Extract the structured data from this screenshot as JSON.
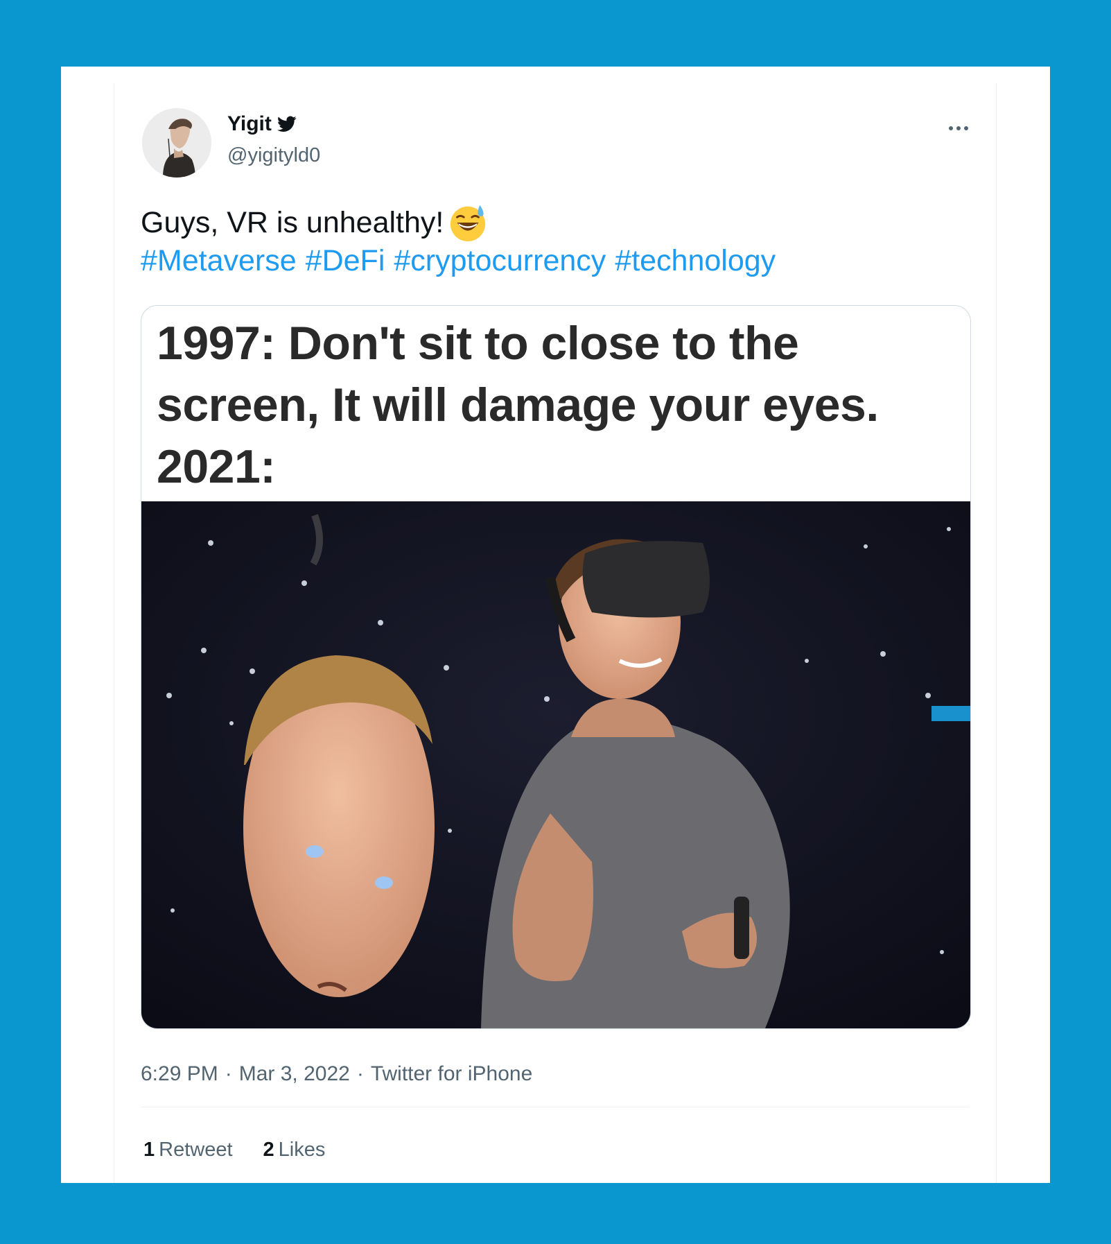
{
  "colors": {
    "background": "#0a97cf",
    "card": "#ffffff",
    "link": "#1d9bf0",
    "text_primary": "#0f1419",
    "text_secondary": "#536471"
  },
  "author": {
    "name": "Yigit",
    "handle": "@yigityld0",
    "verified_icon": "twitter-bird-icon"
  },
  "tweet": {
    "text": "Guys, VR is unhealthy!",
    "emoji": "grinning-face-with-sweat-emoji",
    "hashtags": [
      "#Metaverse",
      "#DeFi",
      "#cryptocurrency",
      "#technology"
    ]
  },
  "media": {
    "caption_lines": [
      "1997: Don't sit to close to the",
      "screen, It will damage your eyes.",
      "2021:"
    ]
  },
  "meta": {
    "time": "6:29 PM",
    "separator": "·",
    "date": "Mar 3, 2022",
    "source": "Twitter for iPhone"
  },
  "stats": {
    "retweets_count": "1",
    "retweets_label": "Retweet",
    "likes_count": "2",
    "likes_label": "Likes"
  }
}
